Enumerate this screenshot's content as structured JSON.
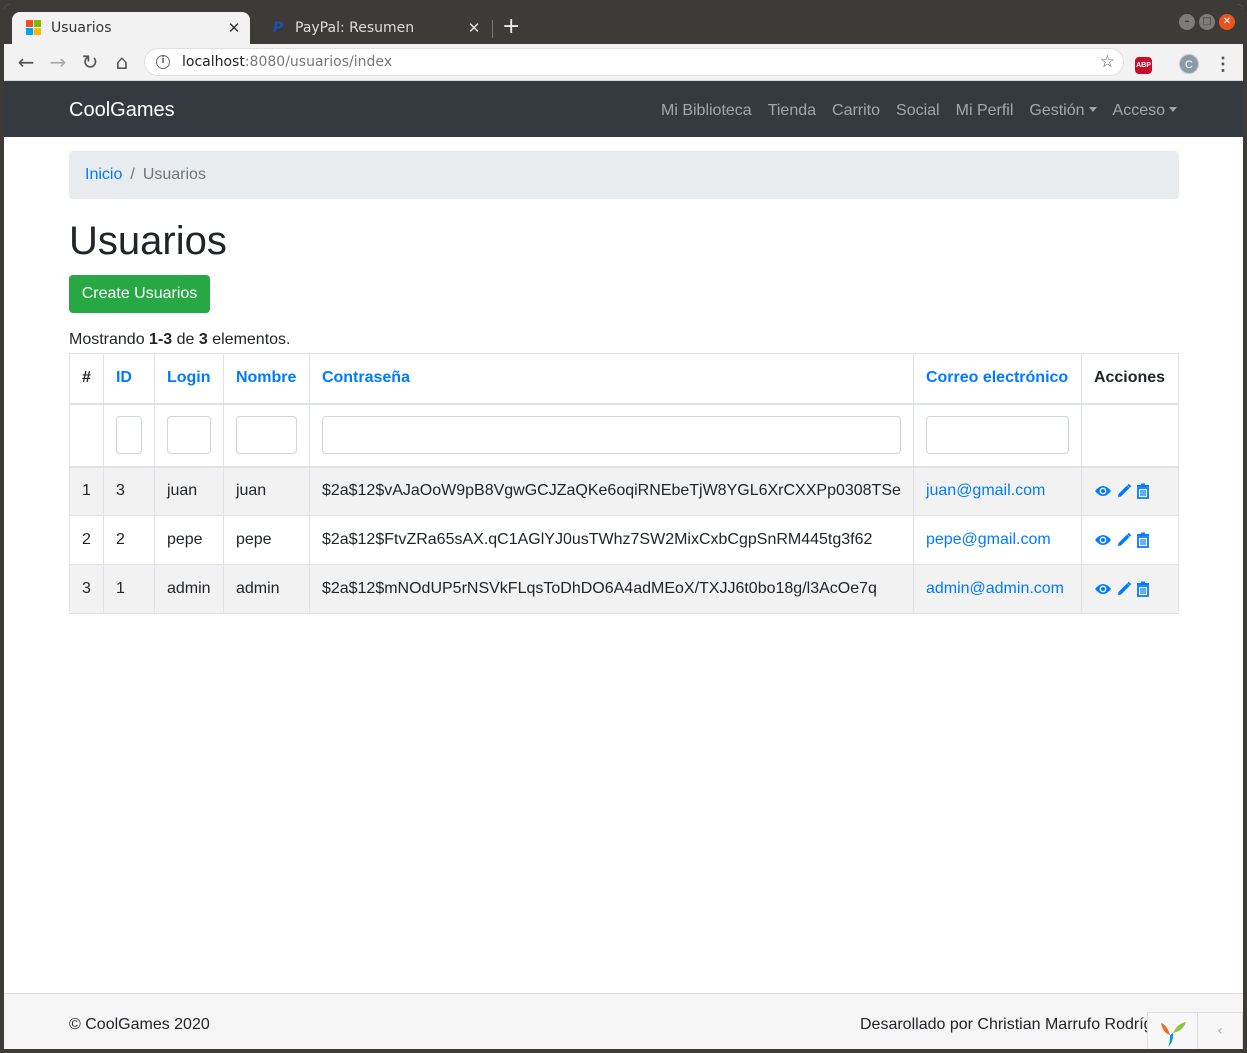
{
  "browser": {
    "tabs": [
      {
        "title": "Usuarios"
      },
      {
        "title": "PayPal: Resumen"
      }
    ],
    "url_host": "localhost",
    "url_path": ":8080/usuarios/index",
    "avatar_letter": "C",
    "abp_label": "ABP"
  },
  "navbar": {
    "brand": "CoolGames",
    "links": [
      "Mi Biblioteca",
      "Tienda",
      "Carrito",
      "Social",
      "Mi Perfil"
    ],
    "dropdowns": [
      "Gestión",
      "Acceso"
    ]
  },
  "breadcrumb": {
    "home": "Inicio",
    "separator": "/",
    "current": "Usuarios"
  },
  "page": {
    "title": "Usuarios",
    "create_button": "Create Usuarios",
    "summary_prefix": "Mostrando ",
    "summary_range": "1-3",
    "summary_mid": " de ",
    "summary_total": "3",
    "summary_suffix": " elementos."
  },
  "table": {
    "headers": [
      "#",
      "ID",
      "Login",
      "Nombre",
      "Contraseña",
      "Correo electrónico",
      "Acciones"
    ],
    "rows": [
      {
        "n": "1",
        "id": "3",
        "login": "juan",
        "nombre": "juan",
        "password": "$2a$12$vAJaOoW9pB8VgwGCJZaQKe6oqiRNEbeTjW8YGL6XrCXXPp0308TSe",
        "email": "juan@gmail.com"
      },
      {
        "n": "2",
        "id": "2",
        "login": "pepe",
        "nombre": "pepe",
        "password": "$2a$12$FtvZRa65sAX.qC1AGlYJ0usTWhz7SW2MixCxbCgpSnRM445tg3f62",
        "email": "pepe@gmail.com"
      },
      {
        "n": "3",
        "id": "1",
        "login": "admin",
        "nombre": "admin",
        "password": "$2a$12$mNOdUP5rNSVkFLqsToDhDO6A4adMEoX/TXJJ6t0bo18g/l3AcOe7q",
        "email": "admin@admin.com"
      }
    ]
  },
  "footer": {
    "copyright": "© CoolGames 2020",
    "developer": "Desarollado por Christian Marrufo Rodríg"
  },
  "colors": {
    "navbar": "#343a40",
    "link": "#007bff",
    "success": "#28a745"
  },
  "icons": {
    "view": "eye-icon",
    "edit": "pencil-icon",
    "delete": "trash-icon"
  }
}
